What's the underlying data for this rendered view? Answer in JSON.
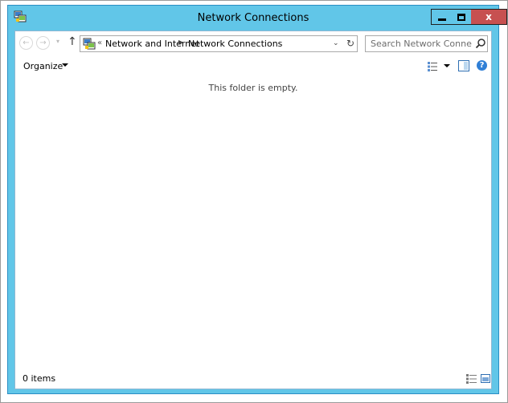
{
  "window": {
    "title": "Network Connections",
    "close_glyph": "x"
  },
  "navigation": {
    "back_glyph": "←",
    "forward_glyph": "→",
    "recent_glyph": "▾",
    "up_glyph": "↑"
  },
  "address_bar": {
    "overflow_glyph": "«",
    "breadcrumbs": [
      "Network and Internet",
      "Network Connections"
    ],
    "separator_glyph": "▶",
    "dropdown_glyph": "⌄",
    "refresh_glyph": "↻"
  },
  "search": {
    "placeholder": "Search Network Connections"
  },
  "toolbar": {
    "organize_label": "Organize",
    "help_glyph": "?"
  },
  "content": {
    "empty_message": "This folder is empty."
  },
  "status_bar": {
    "item_count_text": "0 items"
  },
  "colors": {
    "title_bar": "#61c6e8",
    "close_button": "#c75050",
    "accent_blue": "#2f7fd6"
  },
  "icons": {
    "app": "network-connections-icon",
    "search": "search-icon",
    "views": "view-options-icon",
    "preview_pane": "preview-pane-icon",
    "help": "help-icon",
    "details_view": "details-view-icon",
    "large_icons_view": "large-icons-view-icon"
  }
}
